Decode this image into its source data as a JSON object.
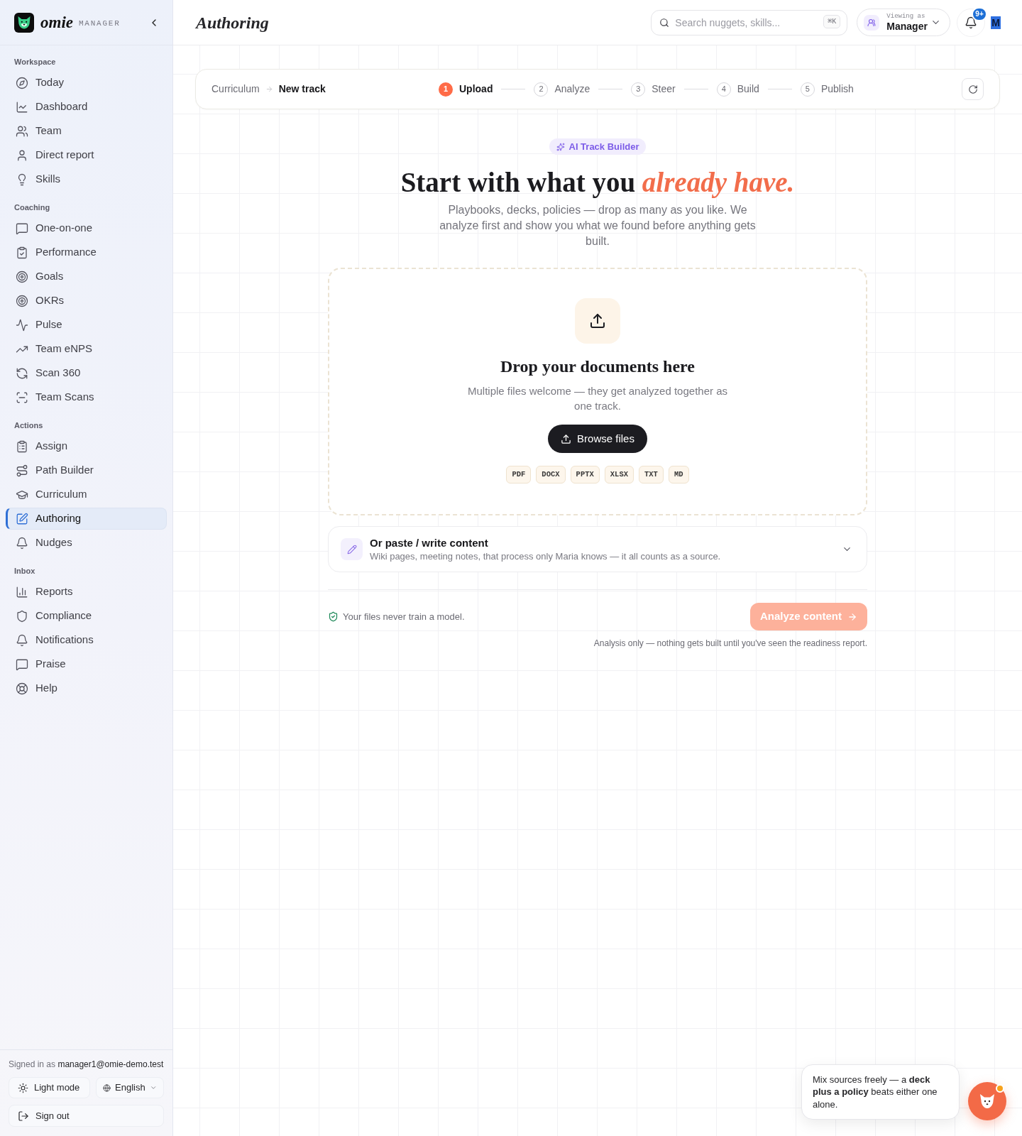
{
  "sidebar": {
    "brand": {
      "name": "omie",
      "tag": "MANAGER"
    },
    "sections": [
      {
        "label": "Workspace",
        "items": [
          {
            "label": "Today",
            "selected": false
          },
          {
            "label": "Dashboard",
            "selected": false
          },
          {
            "label": "Team",
            "selected": false
          },
          {
            "label": "Direct report",
            "selected": false
          },
          {
            "label": "Skills",
            "selected": false
          }
        ]
      },
      {
        "label": "Coaching",
        "items": [
          {
            "label": "One-on-one",
            "selected": false
          },
          {
            "label": "Performance",
            "selected": false
          },
          {
            "label": "Goals",
            "selected": false
          },
          {
            "label": "OKRs",
            "selected": false
          },
          {
            "label": "Pulse",
            "selected": false
          },
          {
            "label": "Team eNPS",
            "selected": false
          },
          {
            "label": "Scan 360",
            "selected": false
          },
          {
            "label": "Team Scans",
            "selected": false
          }
        ]
      },
      {
        "label": "Actions",
        "items": [
          {
            "label": "Assign",
            "selected": false
          },
          {
            "label": "Path Builder",
            "selected": false
          },
          {
            "label": "Curriculum",
            "selected": false
          },
          {
            "label": "Authoring",
            "selected": true
          },
          {
            "label": "Nudges",
            "selected": false
          }
        ]
      },
      {
        "label": "Inbox",
        "items": [
          {
            "label": "Reports",
            "selected": false
          },
          {
            "label": "Compliance",
            "selected": false
          },
          {
            "label": "Notifications",
            "selected": false
          },
          {
            "label": "Praise",
            "selected": false
          },
          {
            "label": "Help",
            "selected": false
          }
        ]
      }
    ],
    "footer": {
      "signed_in": "Signed in as **manager1@omie-demo.test**",
      "theme_button": "Light mode",
      "language": "English",
      "sign_out": "Sign out"
    }
  },
  "header": {
    "title": "Authoring",
    "search": {
      "placeholder": "Search nuggets, skills...",
      "shortcut": "⌘K"
    },
    "role_switcher": {
      "caption": "Viewing as",
      "value": "Manager"
    },
    "notifications": {
      "badge": "9+"
    },
    "avatar": {
      "initial": "M"
    }
  },
  "stepper": {
    "breadcrumb": {
      "parent": "Curriculum",
      "current": "New track"
    },
    "steps": [
      {
        "number": "1",
        "label": "Upload",
        "selected": true
      },
      {
        "number": "2",
        "label": "Analyze",
        "selected": false
      },
      {
        "number": "3",
        "label": "Steer",
        "selected": false
      },
      {
        "number": "4",
        "label": "Build",
        "selected": false
      },
      {
        "number": "5",
        "label": "Publish",
        "selected": false
      }
    ]
  },
  "hero": {
    "badge": "AI Track Builder",
    "heading": "Start with what you *already have.*",
    "description": "Playbooks, decks, policies — drop as many as you like. We analyze first and show you what we found before anything gets built."
  },
  "drop_zone": {
    "title": "Drop your documents here",
    "description": "Multiple files welcome — they get analyzed together as one track.",
    "button": "Browse files",
    "formats": [
      "PDF",
      "DOCX",
      "PPTX",
      "XLSX",
      "TXT",
      "MD"
    ]
  },
  "paste_panel": {
    "title": "Or paste / write content",
    "description": "Wiki pages, meeting notes, that process only Maria knows — it all counts as a source.",
    "expanded": false
  },
  "footer": {
    "note": "Your files never train a model.",
    "analyze_button": {
      "label": "Analyze content",
      "disabled": true
    },
    "caption": "Analysis only — nothing gets built until you've seen the readiness report."
  },
  "tip": {
    "text": "Mix sources freely — a **deck plus a policy** beats either one alone."
  }
}
